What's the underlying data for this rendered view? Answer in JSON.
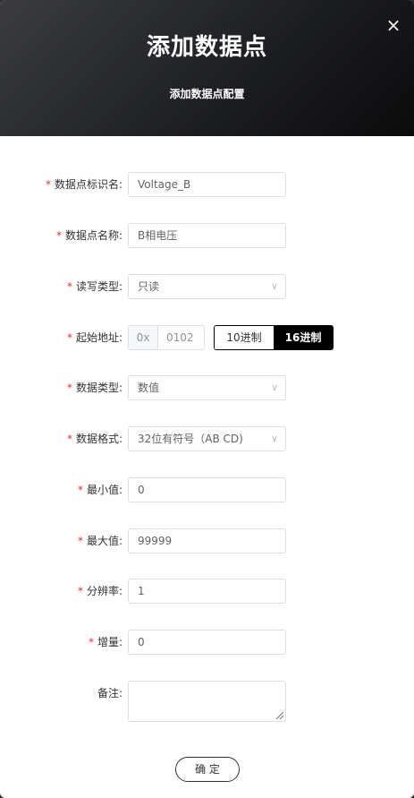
{
  "modal": {
    "title": "添加数据点",
    "subtitle": "添加数据点配置",
    "close_icon": "×"
  },
  "required_mark": "*",
  "form": {
    "identifier": {
      "label": "数据点标识名:",
      "value": "Voltage_B"
    },
    "name": {
      "label": "数据点名称:",
      "value": "B相电压"
    },
    "rw_type": {
      "label": "读写类型:",
      "value": "只读"
    },
    "start_address": {
      "label": "起始地址:",
      "prefix": "0x",
      "value": "0102",
      "radix_options": [
        "10进制",
        "16进制"
      ],
      "radix_selected": "16进制"
    },
    "data_type": {
      "label": "数据类型:",
      "value": "数值"
    },
    "data_format": {
      "label": "数据格式:",
      "value": "32位有符号（AB CD)"
    },
    "min_value": {
      "label": "最小值:",
      "value": "0"
    },
    "max_value": {
      "label": "最大值:",
      "value": "99999"
    },
    "resolution": {
      "label": "分辨率:",
      "value": "1"
    },
    "increment": {
      "label": "增量:",
      "value": "0"
    },
    "remark": {
      "label": "备注:",
      "value": ""
    }
  },
  "confirm_button": "确 定",
  "icons": {
    "dropdown": "chevron-down-icon",
    "close": "close-icon",
    "resize": "resize-grip-icon"
  },
  "colors": {
    "header_dark": "#1c1d20",
    "required": "#e0312f",
    "selected_segment": "#000000"
  }
}
